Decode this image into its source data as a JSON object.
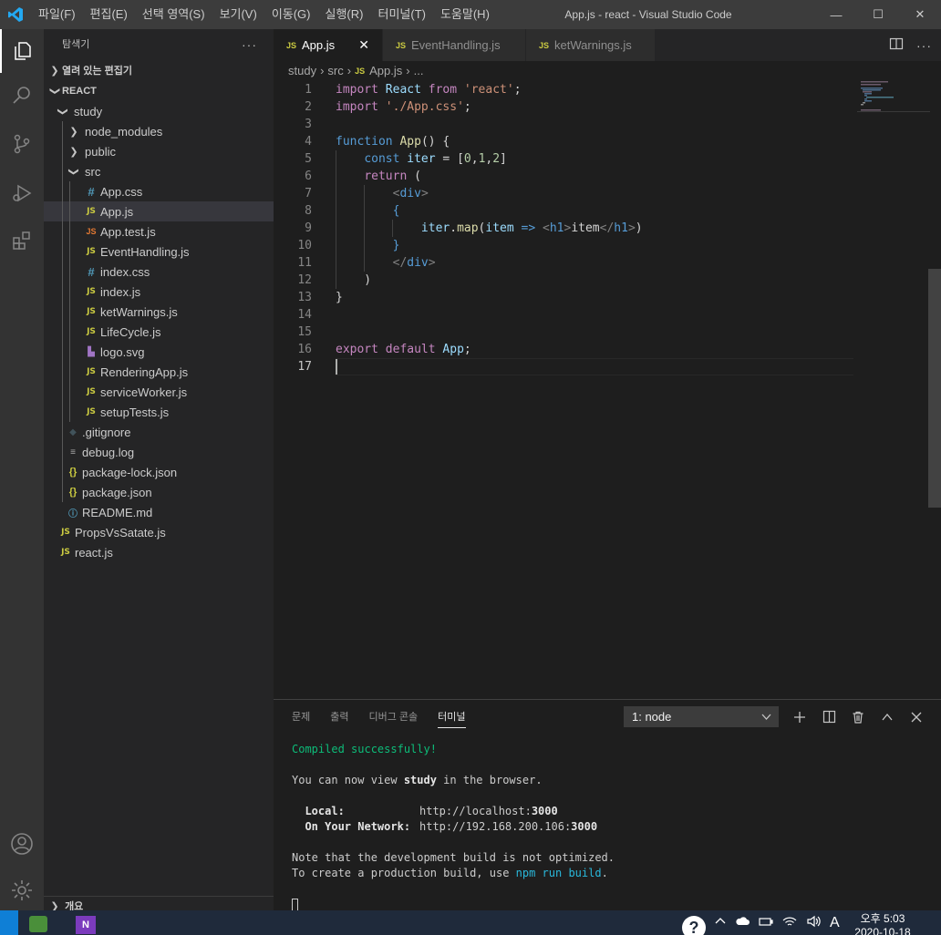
{
  "window": {
    "title": "App.js - react - Visual Studio Code",
    "menu": [
      "파일(F)",
      "편집(E)",
      "선택 영역(S)",
      "보기(V)",
      "이동(G)",
      "실행(R)",
      "터미널(T)",
      "도움말(H)"
    ],
    "controls": {
      "minimize": "—",
      "maximize": "☐",
      "close": "✕"
    }
  },
  "activity_bar": {
    "items": [
      "explorer-icon",
      "search-icon",
      "source-control-icon",
      "run-debug-icon",
      "extensions-icon"
    ],
    "bottom": [
      "account-icon",
      "settings-gear-icon"
    ]
  },
  "sidebar": {
    "title": "탐색기",
    "more": "···",
    "open_editors": "열려 있는 편집기",
    "project": "REACT",
    "outline": "개요",
    "tree": [
      {
        "label": "study",
        "kind": "folder-open",
        "indent": 1
      },
      {
        "label": "node_modules",
        "kind": "folder",
        "indent": 2
      },
      {
        "label": "public",
        "kind": "folder",
        "indent": 2
      },
      {
        "label": "src",
        "kind": "folder-open",
        "indent": 2
      },
      {
        "label": "App.css",
        "kind": "css",
        "indent": 3
      },
      {
        "label": "App.js",
        "kind": "js",
        "indent": 3,
        "selected": true
      },
      {
        "label": "App.test.js",
        "kind": "test",
        "indent": 3
      },
      {
        "label": "EventHandling.js",
        "kind": "js",
        "indent": 3
      },
      {
        "label": "index.css",
        "kind": "css",
        "indent": 3
      },
      {
        "label": "index.js",
        "kind": "js",
        "indent": 3
      },
      {
        "label": "ketWarnings.js",
        "kind": "js",
        "indent": 3
      },
      {
        "label": "LifeCycle.js",
        "kind": "js",
        "indent": 3
      },
      {
        "label": "logo.svg",
        "kind": "svg",
        "indent": 3
      },
      {
        "label": "RenderingApp.js",
        "kind": "js",
        "indent": 3
      },
      {
        "label": "serviceWorker.js",
        "kind": "js",
        "indent": 3
      },
      {
        "label": "setupTests.js",
        "kind": "js",
        "indent": 3
      },
      {
        "label": ".gitignore",
        "kind": "git",
        "indent": 2
      },
      {
        "label": "debug.log",
        "kind": "log",
        "indent": 2
      },
      {
        "label": "package-lock.json",
        "kind": "json",
        "indent": 2
      },
      {
        "label": "package.json",
        "kind": "json",
        "indent": 2
      },
      {
        "label": "README.md",
        "kind": "info",
        "indent": 2
      },
      {
        "label": "PropsVsSatate.js",
        "kind": "js",
        "indent": 1
      },
      {
        "label": "react.js",
        "kind": "js",
        "indent": 1
      }
    ]
  },
  "tabs": [
    {
      "label": "App.js",
      "badge": "JS",
      "active": true,
      "close": "✕"
    },
    {
      "label": "EventHandling.js",
      "badge": "JS",
      "active": false
    },
    {
      "label": "ketWarnings.js",
      "badge": "JS",
      "active": false
    }
  ],
  "breadcrumb": [
    "study",
    "src",
    "App.js",
    "..."
  ],
  "editor": {
    "line_numbers": [
      "1",
      "2",
      "3",
      "4",
      "5",
      "6",
      "7",
      "8",
      "9",
      "10",
      "11",
      "12",
      "13",
      "14",
      "15",
      "16",
      "17"
    ]
  },
  "panel": {
    "tabs": [
      "문제",
      "출력",
      "디버그 콘솔",
      "터미널"
    ],
    "active_tab": "터미널",
    "terminal_select": "1: node",
    "terminal": {
      "compiled": "Compiled successfully!",
      "view_pre": "You can now view ",
      "view_app": "study",
      "view_post": " in the browser.",
      "local_label": "  Local:",
      "local_url_pre": "http://localhost:",
      "local_port": "3000",
      "network_label": "  On Your Network:",
      "network_url_pre": "http://192.168.200.106:",
      "network_port": "3000",
      "note": "Note that the development build is not optimized.",
      "build_pre": "To create a production build, use ",
      "build_cmd": "npm run build",
      "build_post": "."
    }
  },
  "taskbar": {
    "app2_label": "N",
    "tray_ime": "A",
    "time": "오후 5:03",
    "date": "2020-10-18"
  }
}
